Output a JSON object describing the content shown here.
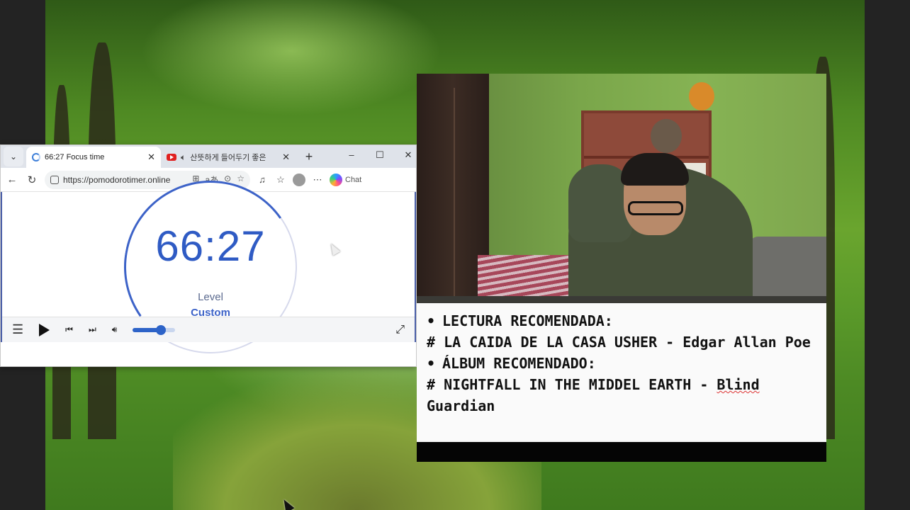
{
  "browser": {
    "tabs": [
      {
        "title": "66:27 Focus time",
        "icon": "timer-favicon",
        "active": true
      },
      {
        "title": "산뜻하게 들어두기 좋은",
        "icon": "youtube-favicon",
        "active": false
      }
    ],
    "new_tab_label": "+",
    "window_controls": {
      "minimize": "–",
      "maximize": "☐",
      "close": "✕"
    },
    "address": "https://pomodorotimer.online",
    "copilot_label": "Chat",
    "accent": "#2f5bc4"
  },
  "timer": {
    "display": "66:27",
    "level_label": "Level",
    "level_value": "Custom"
  },
  "player": {
    "volume_percent": 66
  },
  "recommendations": {
    "reading_heading": "LECTURA RECOMENDADA:",
    "reading_title": "# LA CAIDA DE LA CASA USHER - Edgar Allan Poe",
    "album_heading": "ÁLBUM RECOMENDADO:",
    "album_title_main": "# NIGHTFALL IN THE MIDDEL EARTH - ",
    "album_title_misspelled": "Blind",
    "album_title_end": " Guardian",
    "bullet": "•"
  }
}
